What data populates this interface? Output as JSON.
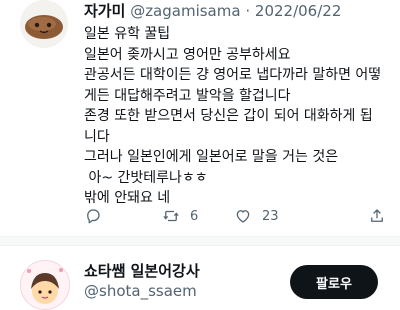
{
  "tweet": {
    "display_name": "자가미",
    "handle": "@zagamisama",
    "separator": "·",
    "date": "2022/06/22",
    "lines": [
      "일본 유학 꿀팁",
      "일본어 좆까시고 영어만 공부하세요",
      "관공서든 대학이든 걍 영어로 냅다까라 말하면 어떻",
      "게든 대답해주려고 발악을 할겁니다",
      "존경 또한 받으면서 당신은 갑이 되어 대화하게 됩",
      "니다",
      "그러나 일본인에게 일본어로 말을 거는 것은",
      " 아~ 간밧테루나ㅎㅎ",
      "밖에 안돼요 네"
    ],
    "actions": {
      "reply_icon": "reply-icon",
      "retweet_icon": "retweet-icon",
      "retweet_count": "6",
      "like_icon": "heart-icon",
      "like_count": "23",
      "share_icon": "share-icon"
    }
  },
  "suggested_account": {
    "name": "쇼타쌤 일본어강사",
    "handle": "@shota_ssaem",
    "follow_label": "팔로우"
  }
}
